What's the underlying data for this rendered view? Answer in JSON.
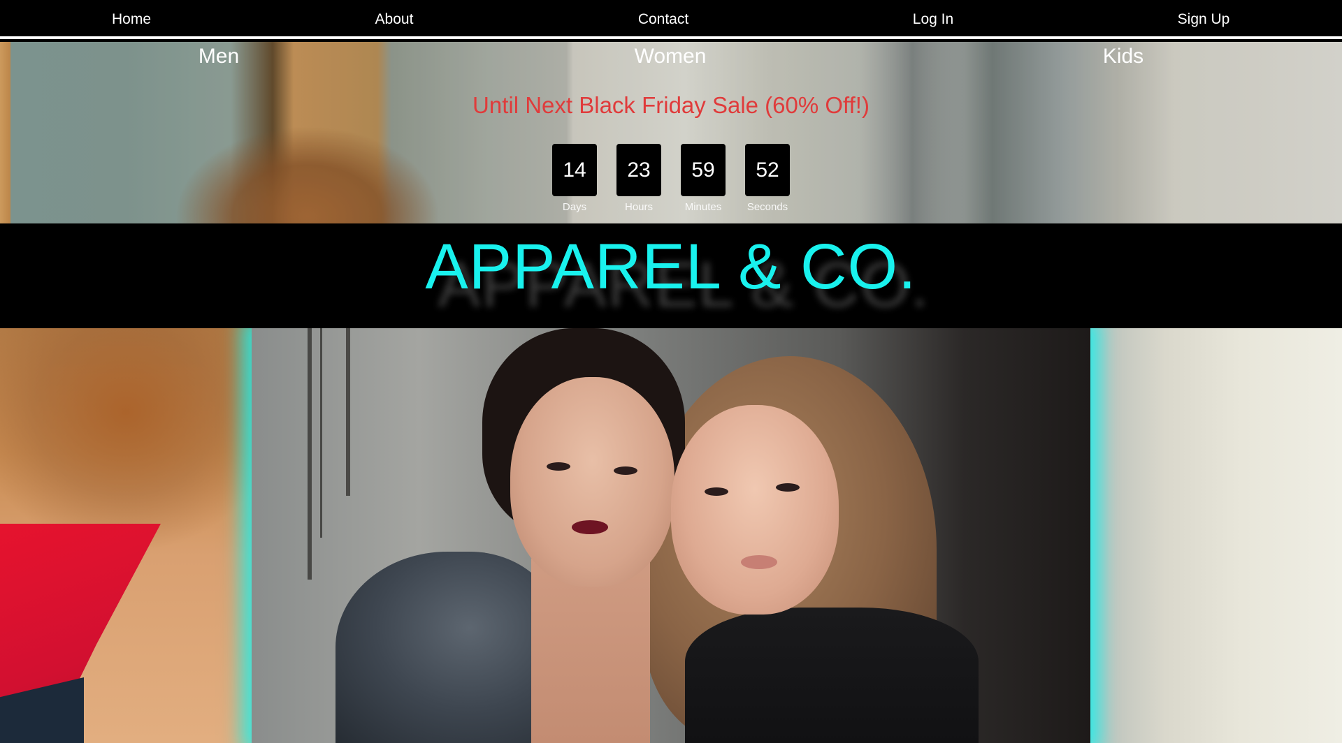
{
  "top_nav": {
    "items": [
      {
        "label": "Home"
      },
      {
        "label": "About"
      },
      {
        "label": "Contact"
      },
      {
        "label": "Log In"
      },
      {
        "label": "Sign Up"
      }
    ]
  },
  "category_nav": {
    "items": [
      {
        "label": "Men"
      },
      {
        "label": "Women"
      },
      {
        "label": "Kids"
      }
    ]
  },
  "sale": {
    "text": "Until Next Black Friday Sale (60% Off!)",
    "color": "#e03b3b"
  },
  "countdown": {
    "units": [
      {
        "value": "14",
        "label": "Days"
      },
      {
        "value": "23",
        "label": "Hours"
      },
      {
        "value": "59",
        "label": "Minutes"
      },
      {
        "value": "52",
        "label": "Seconds"
      }
    ]
  },
  "brand": {
    "title": "APPAREL & CO.",
    "accent_color": "#19f2ee"
  },
  "hero_image": {
    "icon": "photo-models"
  }
}
